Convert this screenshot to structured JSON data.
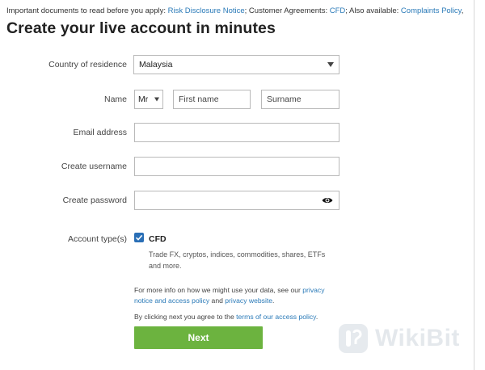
{
  "notice": {
    "prefix": "Important documents to read before you apply: ",
    "risk_link": "Risk Disclosure Notice",
    "mid": "; Customer Agreements: ",
    "cfd_link": "CFD",
    "also": "; Also available: ",
    "complaints_link": "Complaints Policy",
    "suffix": ","
  },
  "title": "Create your live account in minutes",
  "form": {
    "country_label": "Country of residence",
    "country_value": "Malaysia",
    "name_label": "Name",
    "title_value": "Mr",
    "first_name_placeholder": "First name",
    "surname_placeholder": "Surname",
    "email_label": "Email address",
    "username_label": "Create username",
    "password_label": "Create password",
    "account_type_label": "Account type(s)",
    "cfd_option": "CFD",
    "cfd_description": "Trade FX, cryptos, indices, commodities, shares, ETFs and more.",
    "account_checked": true
  },
  "info": {
    "prefix": "For more info on how we might use your data, see our ",
    "privacy_notice_link": "privacy notice and access policy",
    "and": " and ",
    "privacy_website_link": "privacy website",
    "suffix": "."
  },
  "agree": {
    "prefix": "By clicking next you agree to the ",
    "terms_link": "terms of our access policy",
    "suffix": "."
  },
  "next_label": "Next",
  "watermark_text": "WikiBit",
  "colors": {
    "link": "#2a7ab8",
    "button": "#6cb33f",
    "checkbox": "#2a6fb6"
  },
  "icons": {
    "password_toggle": "eye-icon",
    "checkbox": "checkmark-icon"
  }
}
